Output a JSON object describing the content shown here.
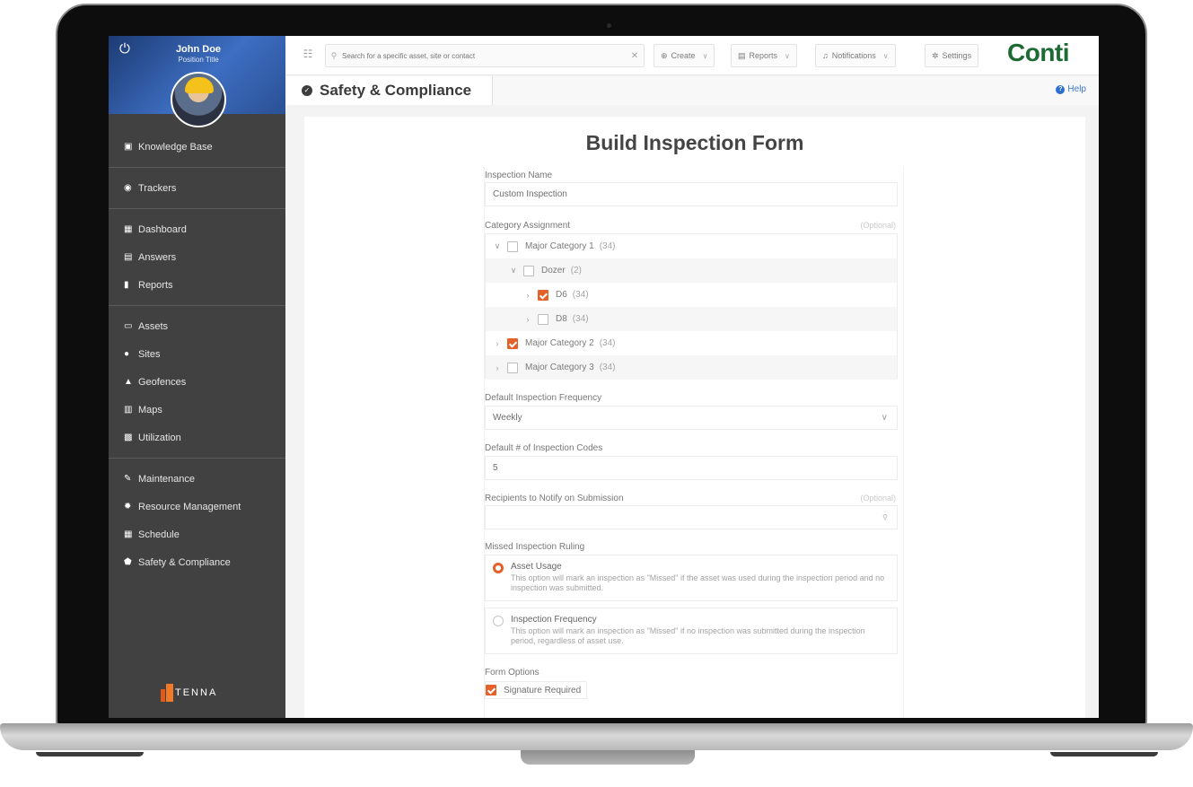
{
  "sidebar": {
    "user_name": "John Doe",
    "user_title": "Position Title",
    "items": [
      {
        "label": "Knowledge Base",
        "icon": "book-icon"
      },
      {
        "label": "Trackers",
        "icon": "tracker-icon"
      },
      {
        "label": "Dashboard",
        "icon": "dashboard-icon"
      },
      {
        "label": "Answers",
        "icon": "chat-icon"
      },
      {
        "label": "Reports",
        "icon": "report-icon"
      },
      {
        "label": "Assets",
        "icon": "asset-icon"
      },
      {
        "label": "Sites",
        "icon": "pin-icon"
      },
      {
        "label": "Geofences",
        "icon": "geofence-icon"
      },
      {
        "label": "Maps",
        "icon": "map-icon"
      },
      {
        "label": "Utilization",
        "icon": "chart-icon"
      },
      {
        "label": "Maintenance",
        "icon": "wrench-icon"
      },
      {
        "label": "Resource Management",
        "icon": "gear-icon"
      },
      {
        "label": "Schedule",
        "icon": "calendar-icon"
      },
      {
        "label": "Safety & Compliance",
        "icon": "shield-icon"
      }
    ],
    "brand": "TENNA"
  },
  "topbar": {
    "search_placeholder": "Search for a specific asset, site or contact",
    "create": "Create",
    "reports": "Reports",
    "notifications": "Notifications",
    "settings": "Settings",
    "logo": "Conti"
  },
  "titlebar": {
    "title": "Safety & Compliance",
    "help": "Help"
  },
  "form": {
    "title": "Build Inspection Form",
    "inspection_name_label": "Inspection Name",
    "inspection_name_value": "Custom Inspection",
    "category_label": "Category Assignment",
    "optional": "(Optional)",
    "tree": [
      {
        "label": "Major Category 1",
        "count": "(34)",
        "checked": false,
        "expanded": true
      },
      {
        "label": "Dozer",
        "count": "(2)",
        "checked": false,
        "expanded": true
      },
      {
        "label": "D6",
        "count": "(34)",
        "checked": true,
        "expanded": false
      },
      {
        "label": "D8",
        "count": "(34)",
        "checked": false,
        "expanded": false
      },
      {
        "label": "Major Category 2",
        "count": "(34)",
        "checked": true,
        "expanded": false
      },
      {
        "label": "Major Category 3",
        "count": "(34)",
        "checked": false,
        "expanded": false
      }
    ],
    "frequency_label": "Default Inspection Frequency",
    "frequency_value": "Weekly",
    "codes_label": "Default # of Inspection Codes",
    "codes_value": "5",
    "recipients_label": "Recipients to Notify on Submission",
    "missed_label": "Missed Inspection Ruling",
    "ruling_options": [
      {
        "title": "Asset Usage",
        "desc": "This option will mark an inspection as \"Missed\" if the asset was used during the inspection period and no inspection was submitted.",
        "selected": true
      },
      {
        "title": "Inspection Frequency",
        "desc": "This option will mark an inspection as \"Missed\" if no inspection was submitted during the inspection period, regardless of asset use.",
        "selected": false
      }
    ],
    "form_options_label": "Form Options",
    "signature_label": "Signature Required",
    "signature_checked": true
  },
  "colors": {
    "accent": "#e4622a",
    "sidebar_bg": "#414141",
    "brand_green": "#1d6a35",
    "link_blue": "#2c6fcf"
  }
}
